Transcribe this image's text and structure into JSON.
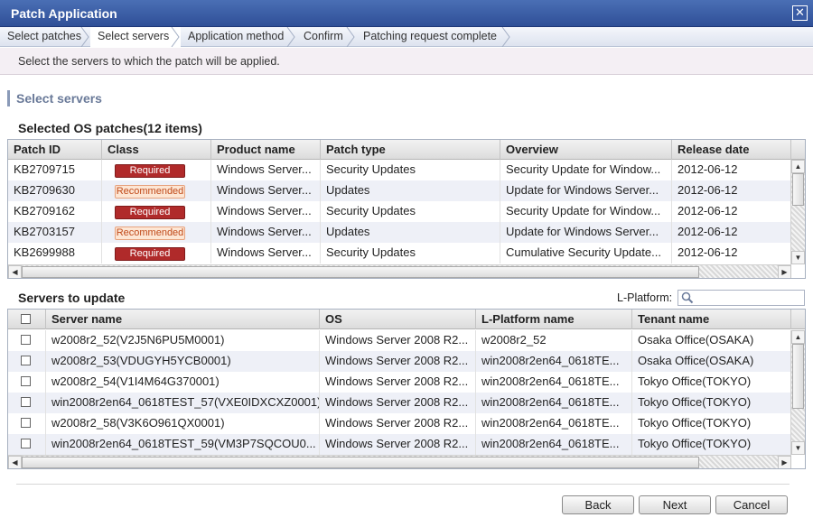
{
  "window": {
    "title": "Patch Application",
    "close_glyph": "✕"
  },
  "steps": [
    "Select patches",
    "Select servers",
    "Application method",
    "Confirm",
    "Patching request complete"
  ],
  "instruction": "Select the servers to which the patch will be applied.",
  "section_title": "Select servers",
  "patches": {
    "title": "Selected OS patches(12 items)",
    "columns": [
      "Patch ID",
      "Class",
      "Product name",
      "Patch type",
      "Overview",
      "Release date"
    ],
    "rows": [
      {
        "id": "KB2709715",
        "class": "Required",
        "product": "Windows Server...",
        "type": "Security Updates",
        "overview": "Security Update for Window...",
        "date": "2012-06-12"
      },
      {
        "id": "KB2709630",
        "class": "Recommended",
        "product": "Windows Server...",
        "type": "Updates",
        "overview": "Update for Windows Server...",
        "date": "2012-06-12"
      },
      {
        "id": "KB2709162",
        "class": "Required",
        "product": "Windows Server...",
        "type": "Security Updates",
        "overview": "Security Update for Window...",
        "date": "2012-06-12"
      },
      {
        "id": "KB2703157",
        "class": "Recommended",
        "product": "Windows Server...",
        "type": "Updates",
        "overview": "Update for Windows Server...",
        "date": "2012-06-12"
      },
      {
        "id": "KB2699988",
        "class": "Required",
        "product": "Windows Server...",
        "type": "Security Updates",
        "overview": "Cumulative Security Update...",
        "date": "2012-06-12"
      }
    ]
  },
  "servers": {
    "title": "Servers to update",
    "filter_label": "L-Platform:",
    "filter_value": "",
    "columns": [
      "Server name",
      "OS",
      "L-Platform name",
      "Tenant name"
    ],
    "rows": [
      {
        "name": "w2008r2_52(V2J5N6PU5M0001)",
        "os": "Windows Server 2008 R2...",
        "lplatform": "w2008r2_52",
        "tenant": "Osaka Office(OSAKA)"
      },
      {
        "name": "w2008r2_53(VDUGYH5YCB0001)",
        "os": "Windows Server 2008 R2...",
        "lplatform": "win2008r2en64_0618TE...",
        "tenant": "Osaka Office(OSAKA)"
      },
      {
        "name": "w2008r2_54(V1I4M64G370001)",
        "os": "Windows Server 2008 R2...",
        "lplatform": "win2008r2en64_0618TE...",
        "tenant": "Tokyo Office(TOKYO)"
      },
      {
        "name": "win2008r2en64_0618TEST_57(VXE0IDXCXZ0001)",
        "os": "Windows Server 2008 R2...",
        "lplatform": "win2008r2en64_0618TE...",
        "tenant": "Tokyo Office(TOKYO)"
      },
      {
        "name": "w2008r2_58(V3K6O961QX0001)",
        "os": "Windows Server 2008 R2...",
        "lplatform": "win2008r2en64_0618TE...",
        "tenant": "Tokyo Office(TOKYO)"
      },
      {
        "name": "win2008r2en64_0618TEST_59(VM3P7SQCOU0...",
        "os": "Windows Server 2008 R2...",
        "lplatform": "win2008r2en64_0618TE...",
        "tenant": "Tokyo Office(TOKYO)"
      }
    ]
  },
  "buttons": {
    "back": "Back",
    "next": "Next",
    "cancel": "Cancel"
  },
  "colors": {
    "title_bar": "#2f4f97",
    "required": "#b02a2a",
    "recommended": "#fde6d4",
    "row_alt": "#eef0f7"
  },
  "icons": {
    "search": "search-icon"
  }
}
